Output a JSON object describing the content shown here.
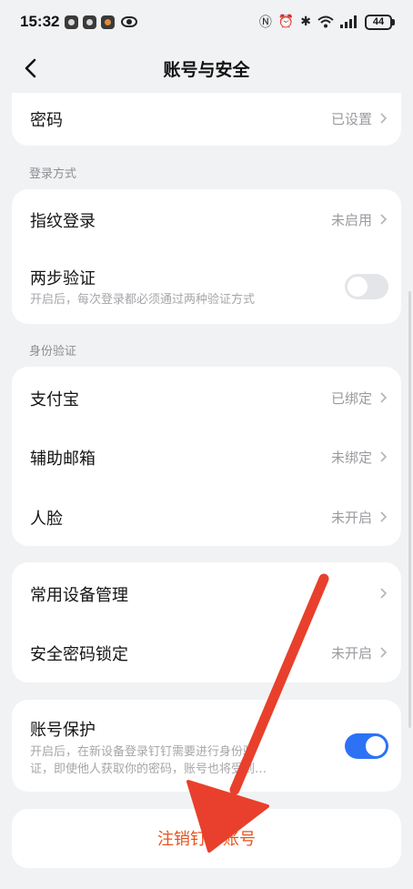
{
  "status": {
    "time": "15:32",
    "battery": "44"
  },
  "nav": {
    "title": "账号与安全"
  },
  "password": {
    "label": "密码",
    "value": "已设置"
  },
  "login_section": {
    "title": "登录方式",
    "fingerprint_label": "指纹登录",
    "fingerprint_value": "未启用",
    "two_step_label": "两步验证",
    "two_step_desc": "开启后，每次登录都必须通过两种验证方式",
    "two_step_enabled": false
  },
  "identity_section": {
    "title": "身份验证",
    "alipay_label": "支付宝",
    "alipay_value": "已绑定",
    "email_label": "辅助邮箱",
    "email_value": "未绑定",
    "face_label": "人脸",
    "face_value": "未开启"
  },
  "device": {
    "devices_label": "常用设备管理",
    "lock_label": "安全密码锁定",
    "lock_value": "未开启"
  },
  "protection": {
    "label": "账号保护",
    "desc_line1": "开启后，在新设备登录钉钉需要进行身份验",
    "desc_line2": "证，即使他人获取你的密码，账号也将受到…",
    "enabled": true
  },
  "logout": {
    "label": "注销钉钉账号"
  },
  "colors": {
    "accent_blue": "#2d72f5",
    "danger_orange": "#e8531d",
    "annotation_red": "#e8402c"
  }
}
